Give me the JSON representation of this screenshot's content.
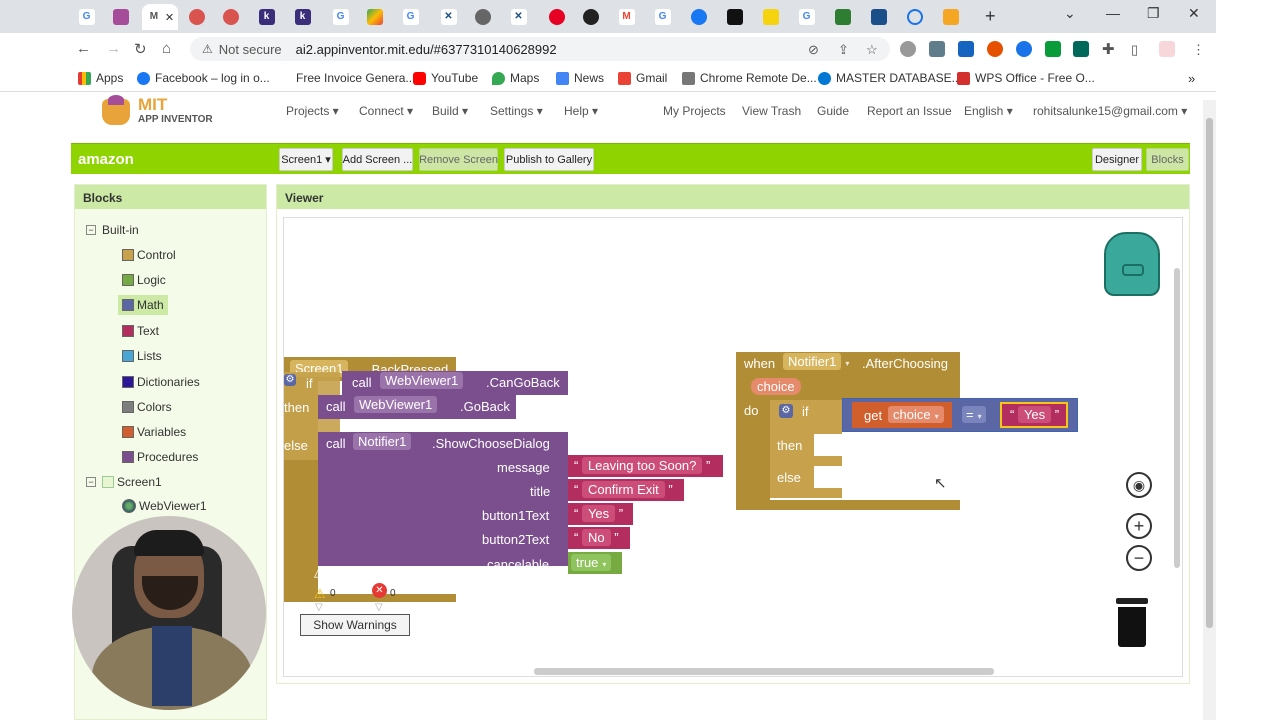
{
  "browser": {
    "url_security": "Not secure",
    "url": "ai2.appinventor.mit.edu/#6377310140628992",
    "bookmarks": [
      "Apps",
      "Facebook – log in o...",
      "Free Invoice Genera...",
      "YouTube",
      "Maps",
      "News",
      "Gmail",
      "Chrome Remote De...",
      "MASTER DATABASE...",
      "WPS Office - Free O..."
    ],
    "tab_letters": [
      "G",
      "",
      "M",
      "",
      "",
      "k",
      "k",
      "G",
      "",
      "G",
      "✕",
      "",
      "✕",
      "",
      "",
      "M",
      "G",
      "",
      "",
      "",
      "G",
      "",
      "",
      "",
      "",
      "",
      ""
    ],
    "new_tab": "+",
    "window_controls": [
      "⌄",
      "—",
      "❐",
      "✕"
    ]
  },
  "app": {
    "logo_mit": "MIT",
    "logo_subtitle": "APP INVENTOR",
    "menus": [
      "Projects ▾",
      "Connect ▾",
      "Build ▾",
      "Settings ▾",
      "Help ▾"
    ],
    "right_menus": [
      "My Projects",
      "View Trash",
      "Guide",
      "Report an Issue",
      "English ▾",
      "rohitsalunke15@gmail.com ▾"
    ],
    "project_name": "amazon",
    "screen_button": "Screen1 ▾",
    "add_screen": "Add Screen ...",
    "remove_screen": "Remove Screen",
    "publish": "Publish to Gallery",
    "designer": "Designer",
    "blocks_btn": "Blocks"
  },
  "blocks_panel": {
    "title": "Blocks",
    "builtin": "Built-in",
    "items": [
      {
        "label": "Control",
        "color": "#c7a14b"
      },
      {
        "label": "Logic",
        "color": "#77ab41"
      },
      {
        "label": "Math",
        "color": "#5b67a5"
      },
      {
        "label": "Text",
        "color": "#b32d5e"
      },
      {
        "label": "Lists",
        "color": "#49a6d4"
      },
      {
        "label": "Dictionaries",
        "color": "#2d1799"
      },
      {
        "label": "Colors",
        "color": "#7d7d7d"
      },
      {
        "label": "Variables",
        "color": "#d05f2d"
      },
      {
        "label": "Procedures",
        "color": "#7b4f8e"
      }
    ],
    "screen": "Screen1",
    "webviewer": "WebViewer1"
  },
  "viewer": {
    "title": "Viewer",
    "block1": {
      "component": "Screen1",
      "event": ".BackPressed",
      "if": "if",
      "then": "then",
      "else": "else",
      "call": "call",
      "webviewer": "WebViewer1",
      "cangoback": ".CanGoBack",
      "goback": ".GoBack",
      "notifier": "Notifier1",
      "show_dialog": ".ShowChooseDialog",
      "args": [
        "message",
        "title",
        "button1Text",
        "button2Text",
        "cancelable"
      ],
      "values": [
        "Leaving too Soon?",
        "Confirm Exit",
        "Yes",
        "No"
      ],
      "cancelable_value": "true"
    },
    "block2": {
      "when": "when",
      "component": "Notifier1",
      "event": ".AfterChoosing",
      "param": "choice",
      "do": "do",
      "if": "if",
      "then": "then",
      "else": "else",
      "get": "get",
      "var": "choice",
      "op": "=",
      "value": "Yes"
    },
    "warnings_count": "0",
    "errors_count": "0",
    "show_warnings": "Show Warnings"
  }
}
